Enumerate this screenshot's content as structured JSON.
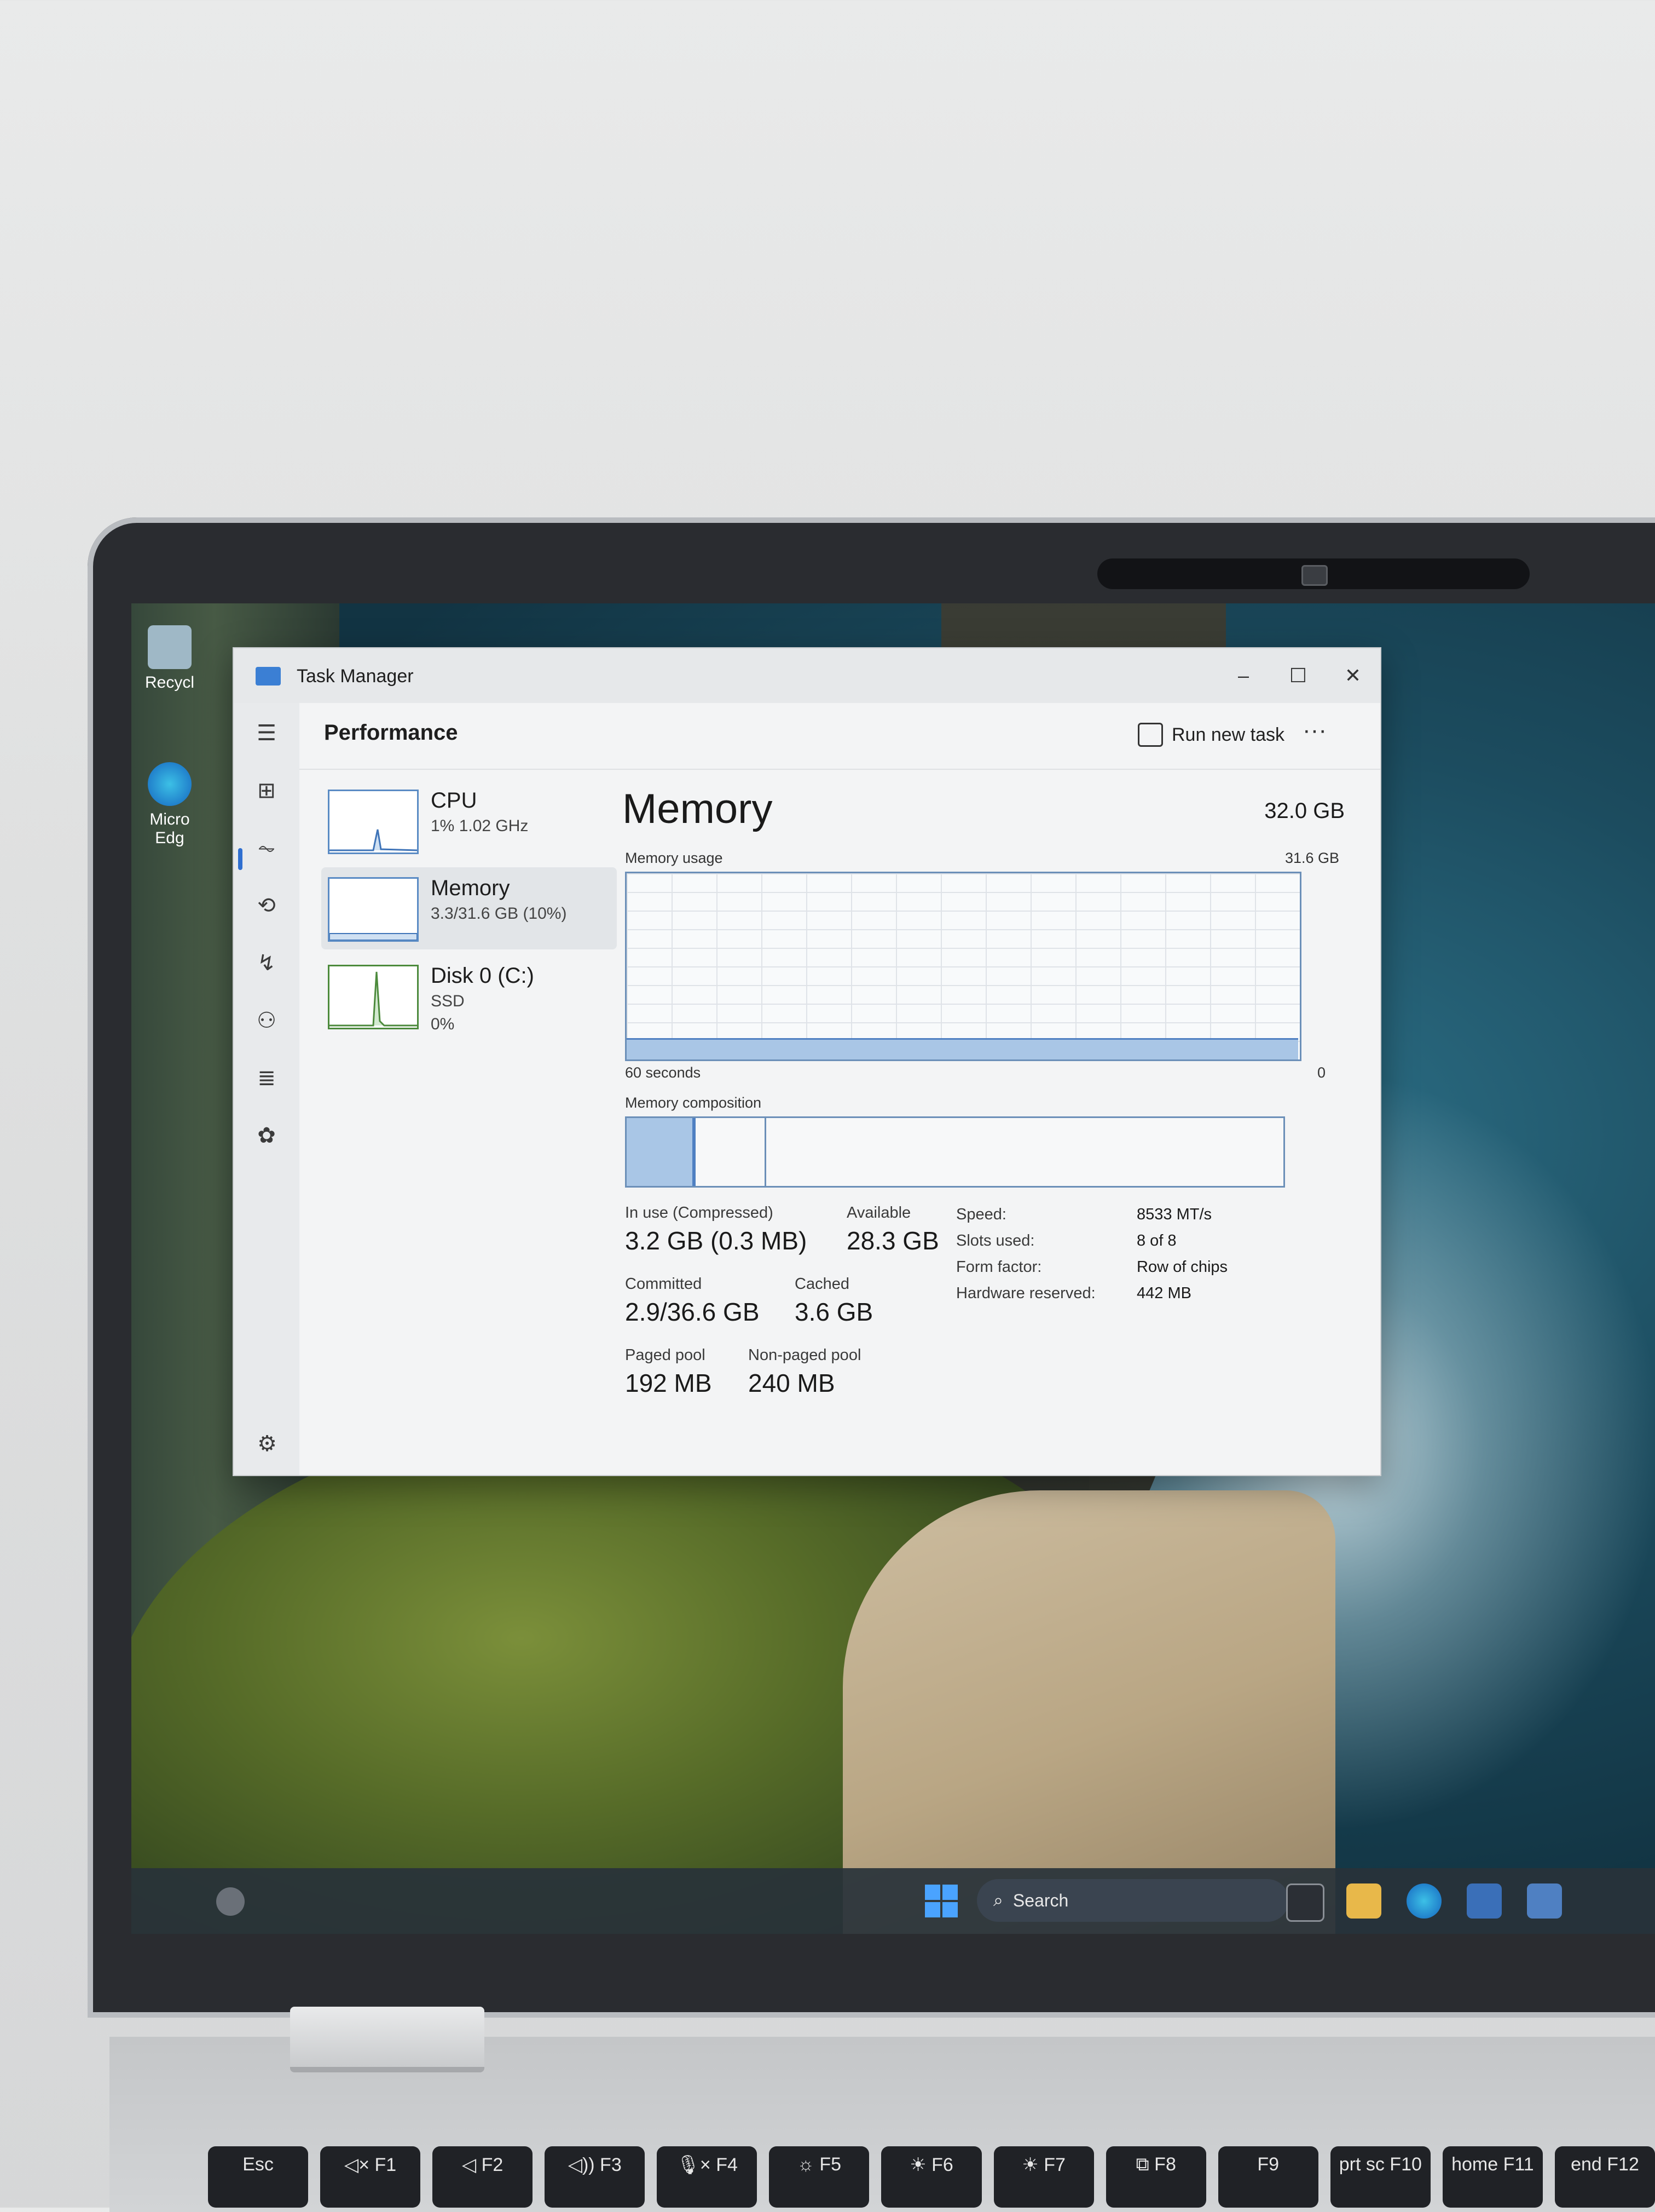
{
  "desktop": {
    "icons": [
      {
        "label": "Recycl",
        "icon": "recycle-bin-icon"
      },
      {
        "label": "Micro Edg",
        "icon": "edge-icon"
      }
    ]
  },
  "window": {
    "title": "Task Manager",
    "controls": {
      "minimize": "–",
      "maximize": "☐",
      "close": "✕"
    }
  },
  "header": {
    "page_title": "Performance",
    "run_new_task": "Run new task",
    "more": "···"
  },
  "resources": [
    {
      "name": "CPU",
      "sub": "1% 1.02 GHz",
      "sub2": ""
    },
    {
      "name": "Memory",
      "sub": "3.3/31.6 GB (10%)",
      "sub2": ""
    },
    {
      "name": "Disk 0 (C:)",
      "sub": "SSD",
      "sub2": "0%"
    }
  ],
  "memory": {
    "heading": "Memory",
    "total": "32.0 GB",
    "usage_label": "Memory usage",
    "usage_max": "31.6 GB",
    "usage_fraction": 0.1,
    "graph_left_label": "60 seconds",
    "graph_right_label": "0",
    "composition_label": "Memory composition",
    "composition_in_use_fraction": 0.1,
    "composition_divider_fraction": 0.21,
    "stats": {
      "in_use_label": "In use (Compressed)",
      "in_use_value": "3.2 GB (0.3 MB)",
      "available_label": "Available",
      "available_value": "28.3 GB",
      "committed_label": "Committed",
      "committed_value": "2.9/36.6 GB",
      "cached_label": "Cached",
      "cached_value": "3.6 GB",
      "paged_label": "Paged pool",
      "paged_value": "192 MB",
      "nonpaged_label": "Non-paged pool",
      "nonpaged_value": "240 MB"
    },
    "specs": [
      {
        "label": "Speed:",
        "value": "8533 MT/s"
      },
      {
        "label": "Slots used:",
        "value": "8 of 8"
      },
      {
        "label": "Form factor:",
        "value": "Row of chips"
      },
      {
        "label": "Hardware reserved:",
        "value": "442 MB"
      }
    ]
  },
  "taskbar": {
    "search_placeholder": "Search"
  },
  "keyboard": {
    "keys": [
      "Esc",
      "◁× F1",
      "◁ F2",
      "◁)) F3",
      "🎙× F4",
      "☼ F5",
      "☀ F6",
      "☀ F7",
      "⧉ F8",
      "F9",
      "prt sc F10",
      "home F11",
      "end F12"
    ]
  },
  "colors": {
    "accent": "#2f6fd0",
    "graph_line": "#4f80c2",
    "graph_fill": "#a9c6e6"
  }
}
